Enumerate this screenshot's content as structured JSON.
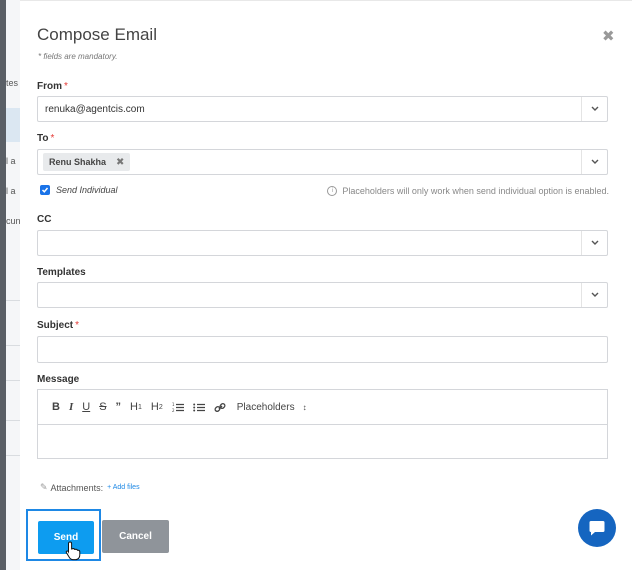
{
  "background": {
    "fragments": [
      "tes",
      "l a",
      "l a",
      "cun"
    ]
  },
  "modal": {
    "title": "Compose Email",
    "mandatory_note": "* fields are mandatory."
  },
  "from": {
    "label": "From",
    "required_mark": "*",
    "value": "renuka@agentcis.com"
  },
  "to": {
    "label": "To",
    "required_mark": "*",
    "tag": "Renu Shakha",
    "tag_remove": "✖"
  },
  "send_individual": {
    "label": "Send Individual",
    "checked": true
  },
  "placeholder_hint": "Placeholders will only work when send individual option is enabled.",
  "cc": {
    "label": "CC",
    "value": ""
  },
  "templates": {
    "label": "Templates",
    "value": ""
  },
  "subject": {
    "label": "Subject",
    "required_mark": "*",
    "value": ""
  },
  "message": {
    "label": "Message",
    "toolbar": {
      "bold": "B",
      "italic": "I",
      "underline": "U",
      "strike": "S",
      "quote": "”",
      "h1": "H",
      "h1_sub": "1",
      "h2": "H",
      "h2_sub": "2",
      "placeholders": "Placeholders",
      "placeholders_arrow": "↕"
    }
  },
  "attachments": {
    "label": "Attachments:",
    "add_link": "+ Add files"
  },
  "buttons": {
    "send": "Send",
    "cancel": "Cancel"
  },
  "colors": {
    "send": "#0d9cf0",
    "cancel": "#8f949a",
    "chat": "#1565c0",
    "required": "#e53935",
    "link": "#1e88e5"
  },
  "icons": {
    "close": "close-icon",
    "chevron": "chevron-down-icon",
    "info": "info-icon",
    "clip": "paperclip-icon",
    "chat": "chat-bubble-icon",
    "cursor": "hand-pointer-icon"
  }
}
